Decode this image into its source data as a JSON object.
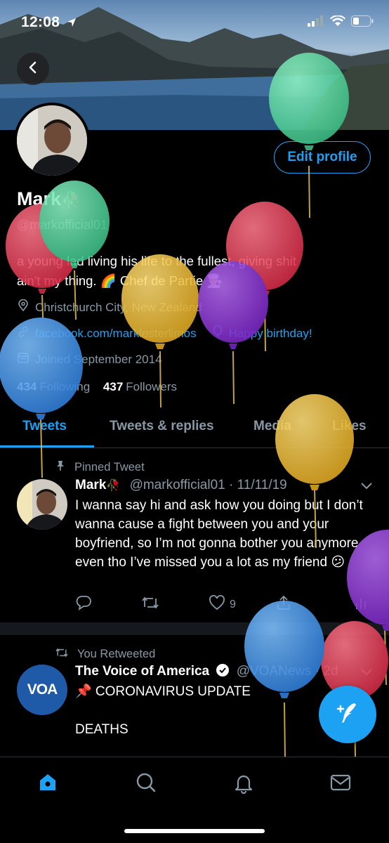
{
  "status": {
    "time": "12:08"
  },
  "profile": {
    "edit_label": "Edit profile",
    "name": "Mark",
    "name_emoji": "🥀",
    "handle": "@markofficial01",
    "bio_line1": "a young lad living his life to the fullest, giving shit",
    "bio_line2": "ain't my thing. 🌈 Chef de Partie 👨‍🍳",
    "location": "Christchurch City, New Zealand",
    "link": "facebook.com/marklesterlimos",
    "birthday": "Happy birthday!",
    "joined": "Joined September 2014",
    "following_count": "434",
    "following_label": "Following",
    "followers_count": "437",
    "followers_label": "Followers"
  },
  "tabs": [
    "Tweets",
    "Tweets & replies",
    "Media",
    "Likes"
  ],
  "tweets": [
    {
      "context": "Pinned Tweet",
      "name": "Mark",
      "name_emoji": "🥀",
      "handle_date": "@markofficial01 · 11/11/19",
      "text": "I wanna say hi and ask how you doing but I don’t wanna cause a fight between you and your boyfriend, so I’m not gonna bother you anymore even tho I’ve missed you a lot as my friend 😕",
      "likes": "9"
    },
    {
      "context": "You Retweeted",
      "name": "The Voice of America",
      "handle_date": "@VOANews · 2d",
      "avatar_text": "VOA",
      "text_line1": "📌 CORONAVIRUS UPDATE",
      "text_line2": "DEATHS"
    }
  ],
  "colors": {
    "accent": "#1da1f2",
    "secondary": "#8899a6",
    "background": "#000000"
  },
  "icons": [
    "back-icon",
    "signal-icon",
    "wifi-icon",
    "battery-icon",
    "location-icon",
    "link-icon",
    "balloon-icon",
    "calendar-icon",
    "pin-icon",
    "retweet-icon",
    "reply-icon",
    "like-icon",
    "share-icon",
    "analytics-icon",
    "chevron-down-icon",
    "verified-icon",
    "home-icon",
    "search-icon",
    "notifications-icon",
    "messages-icon",
    "compose-icon"
  ]
}
